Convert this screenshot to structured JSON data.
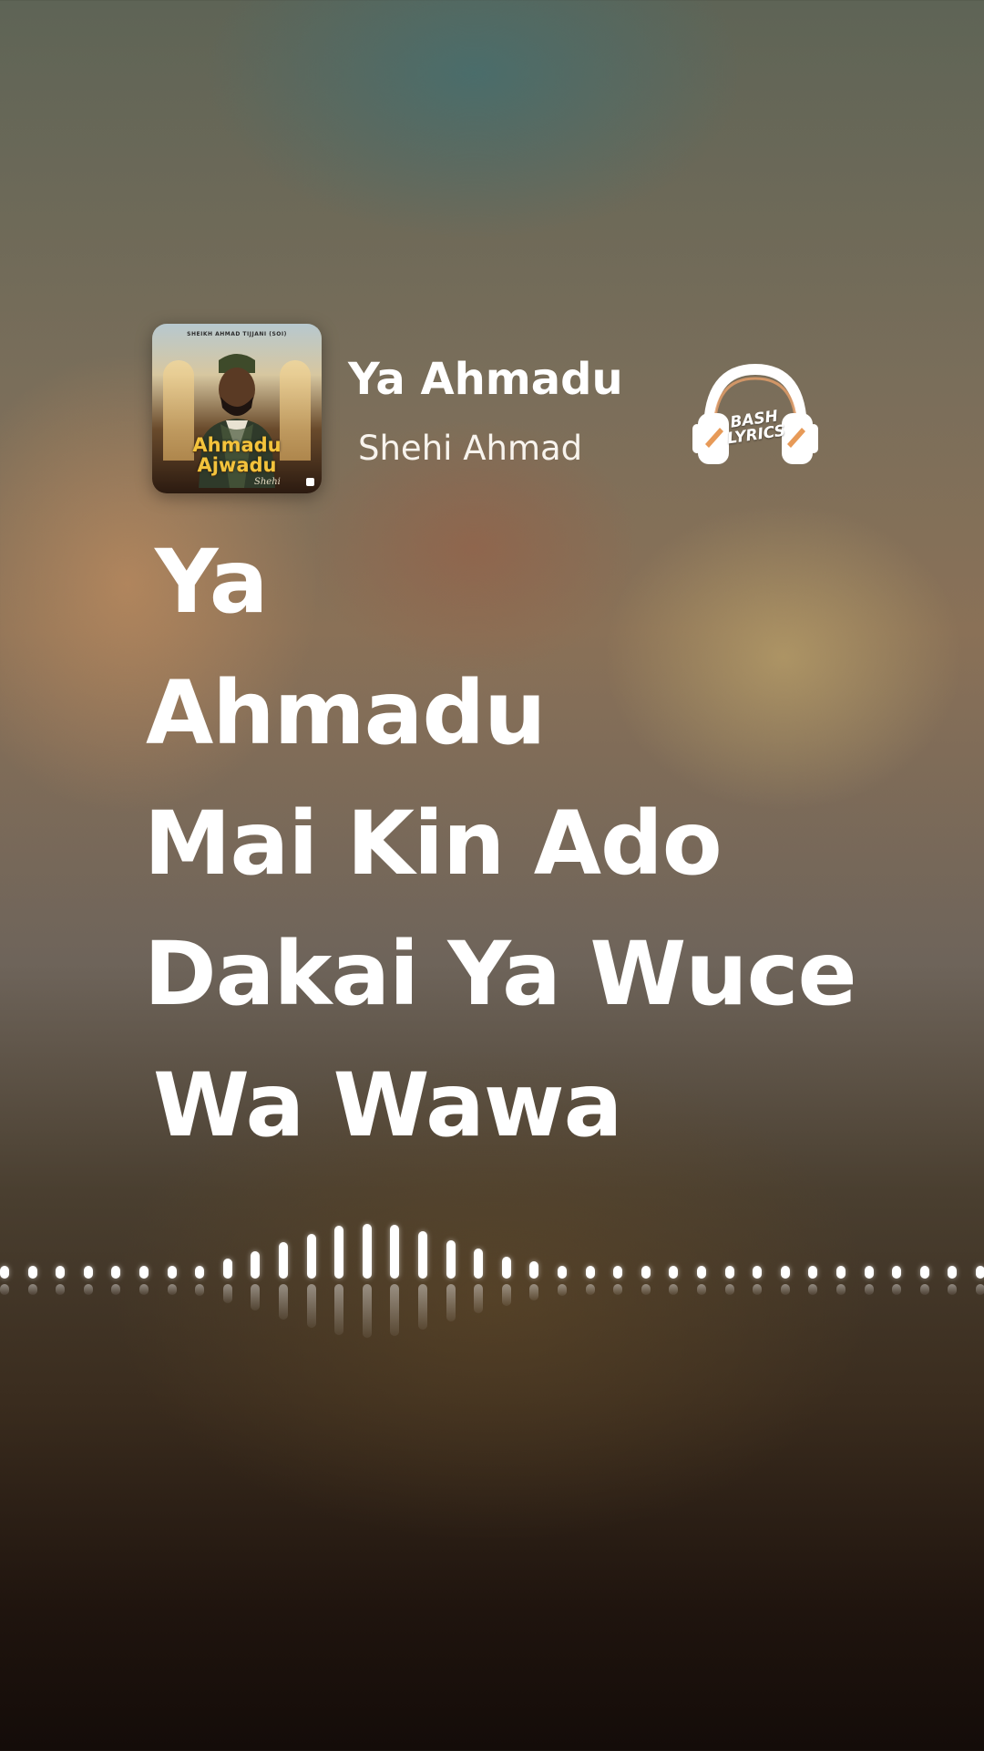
{
  "now_playing": {
    "song_title": "Ya Ahmadu",
    "artist": "Shehi Ahmad",
    "cover_art": {
      "top_text": "SHEIKH AHMAD TIJJANI (SOI)",
      "title_line1": "Ahmadu",
      "title_line2": "Ajwadu",
      "signature": "Shehi"
    }
  },
  "brand_logo": {
    "line1": "BASH",
    "line2": "LYRICS",
    "icon": "headphones-icon"
  },
  "lyrics": {
    "lines": [
      "Ya",
      "Ahmadu",
      "Mai Kin Ado",
      "Dakai Ya Wuce",
      "Wa Wawa"
    ]
  },
  "visualizer": {
    "levels": [
      0.1,
      0.1,
      0.1,
      0.1,
      0.1,
      0.1,
      0.12,
      0.18,
      0.3,
      0.42,
      0.55,
      0.68,
      0.8,
      0.84,
      0.82,
      0.72,
      0.58,
      0.46,
      0.34,
      0.26,
      0.18,
      0.14,
      0.12,
      0.1,
      0.1,
      0.1,
      0.1,
      0.1,
      0.1,
      0.1,
      0.1,
      0.1,
      0.1,
      0.1,
      0.1,
      0.1
    ]
  },
  "colors": {
    "text": "#ffffff",
    "cover_title": "#f3c33c"
  }
}
